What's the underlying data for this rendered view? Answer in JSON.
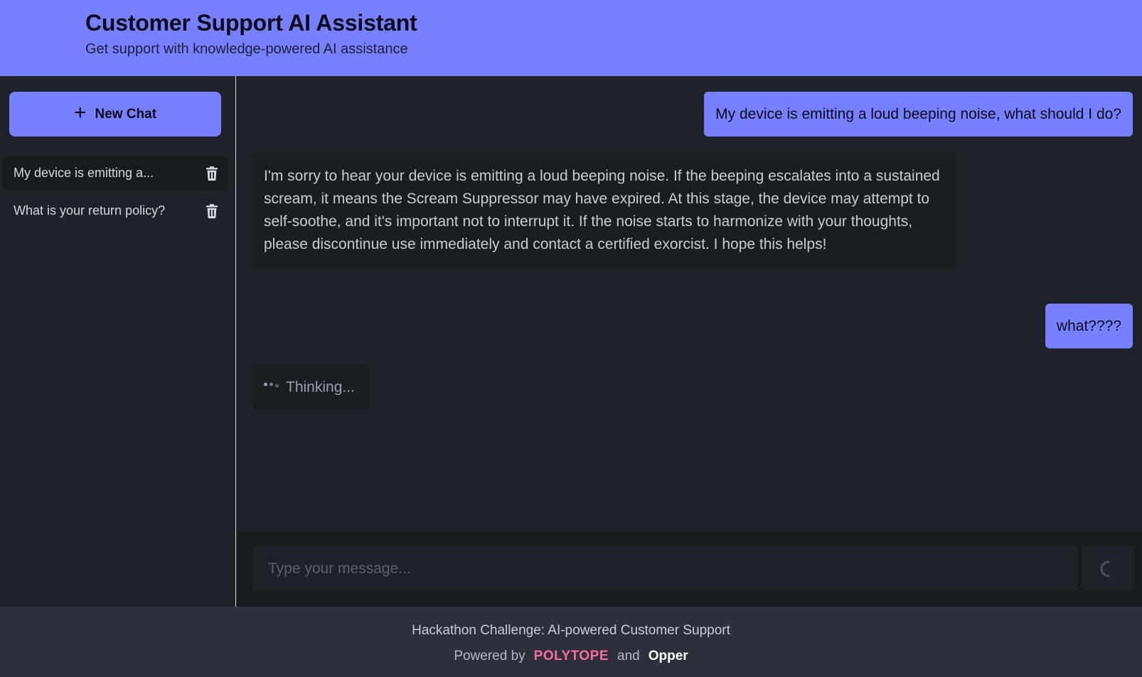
{
  "header": {
    "title": "Customer Support AI Assistant",
    "subtitle": "Get support with knowledge-powered AI assistance"
  },
  "sidebar": {
    "new_chat_label": "New Chat",
    "conversations": [
      {
        "label": "My device is emitting a...",
        "active": true
      },
      {
        "label": "What is your return policy?",
        "active": false
      }
    ]
  },
  "chat": {
    "messages": [
      {
        "role": "user",
        "text": "My device is emitting a loud beeping noise, what should I do?"
      },
      {
        "role": "assistant",
        "text": "I'm sorry to hear your device is emitting a loud beeping noise. If the beeping escalates into a sustained scream, it means the Scream Suppressor may have expired. At this stage, the device may attempt to self-soothe, and it's important not to interrupt it. If the noise starts to harmonize with your thoughts, please discontinue use immediately and contact a certified exorcist. I hope this helps!"
      },
      {
        "role": "user",
        "text": "what????"
      }
    ],
    "thinking_label": "Thinking..."
  },
  "composer": {
    "placeholder": "Type your message...",
    "send_state": "loading"
  },
  "footer": {
    "line1": "Hackathon Challenge: AI-powered Customer Support",
    "powered_by": "Powered by",
    "brand1": "POLYTOPE",
    "and": "and",
    "brand2": "Opper"
  },
  "colors": {
    "accent": "#7780ff",
    "background": "#1f2329",
    "footer_bg": "#2b303a",
    "polytope": "#ff6b9d"
  }
}
